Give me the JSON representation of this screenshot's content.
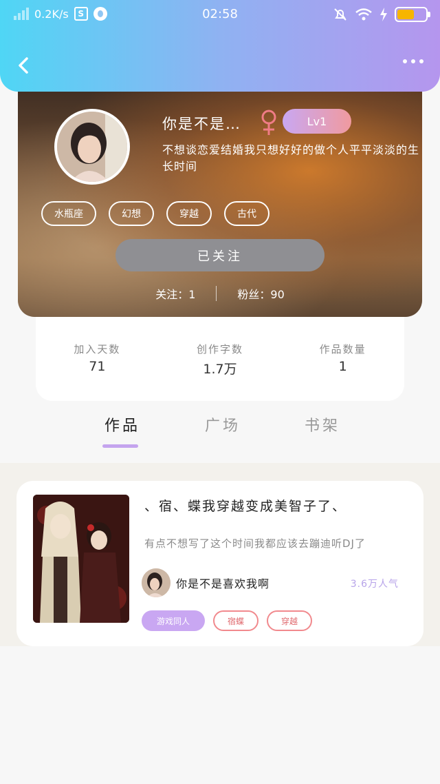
{
  "statusbar": {
    "network_speed": "0.2K/s",
    "app_badge": "S",
    "time": "02:58",
    "battery_color": "#f7b500"
  },
  "header": {
    "back_icon": "chevron-left-icon",
    "more_icon": "more-dots-icon",
    "gradient_start": "#4fd6f5",
    "gradient_end": "#b596ee"
  },
  "profile": {
    "username": "你是不是…",
    "gender_icon": "female-icon",
    "level": "Lv1",
    "bio": "不想谈恋爱结婚我只想好好的做个人平平淡淡的生长时间",
    "tags": [
      "水瓶座",
      "幻想",
      "穿越",
      "古代"
    ],
    "follow_button": "已关注",
    "following_label": "关注：",
    "following_count": "1",
    "fans_label": "粉丝：",
    "fans_count": "90"
  },
  "stats": [
    {
      "label": "加入天数",
      "value": "71"
    },
    {
      "label": "创作字数",
      "value": "1.7万"
    },
    {
      "label": "作品数量",
      "value": "1"
    }
  ],
  "tabs": [
    {
      "label": "作品",
      "active": true
    },
    {
      "label": "广场",
      "active": false
    },
    {
      "label": "书架",
      "active": false
    }
  ],
  "work": {
    "title": "、宿、蝶我穿越变成美智子了、",
    "description": "有点不想写了这个时间我都应该去蹦迪听DJ了",
    "author": "你是不是喜欢我啊",
    "popularity": "3.6万人气",
    "tags": [
      "游戏同人",
      "宿蝶",
      "穿越"
    ]
  },
  "colors": {
    "accent_purple": "#c4a4ee",
    "tag_red": "#f1898d",
    "follow_button_gray": "#8f8f93"
  }
}
